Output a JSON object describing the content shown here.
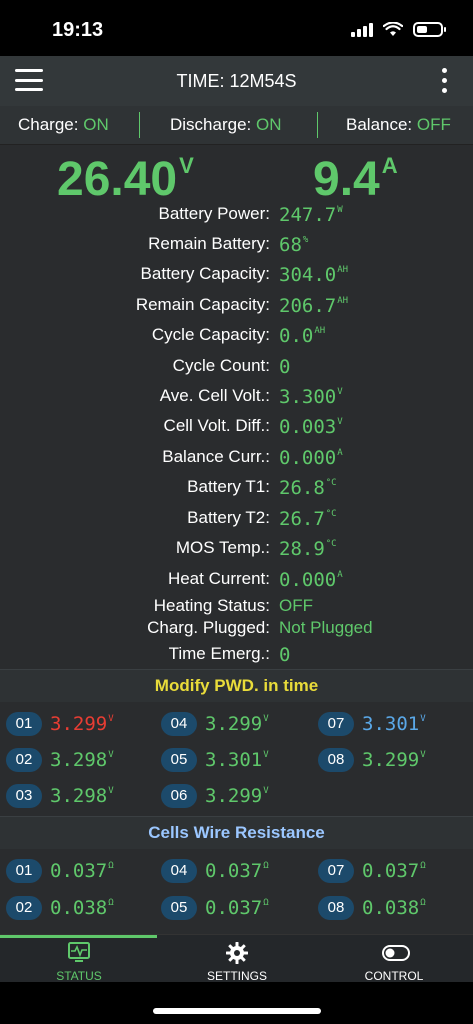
{
  "status_bar": {
    "time": "19:13"
  },
  "header": {
    "title": "TIME: 12M54S"
  },
  "switches": {
    "charge_label": "Charge:",
    "charge_value": "ON",
    "discharge_label": "Discharge:",
    "discharge_value": "ON",
    "balance_label": "Balance:",
    "balance_value": "OFF"
  },
  "main": {
    "voltage": "26.40",
    "voltage_unit": "V",
    "current": "9.4",
    "current_unit": "A"
  },
  "info": [
    {
      "label": "Battery Power:",
      "value": "247.7",
      "unit": "W"
    },
    {
      "label": "Remain Battery:",
      "value": "68",
      "unit": "%"
    },
    {
      "label": "Battery Capacity:",
      "value": "304.0",
      "unit": "AH"
    },
    {
      "label": "Remain Capacity:",
      "value": "206.7",
      "unit": "AH"
    },
    {
      "label": "Cycle Capacity:",
      "value": "0.0",
      "unit": "AH"
    },
    {
      "label": "Cycle Count:",
      "value": "0",
      "unit": ""
    },
    {
      "label": "Ave. Cell Volt.:",
      "value": "3.300",
      "unit": "V"
    },
    {
      "label": "Cell Volt. Diff.:",
      "value": "0.003",
      "unit": "V"
    },
    {
      "label": "Balance Curr.:",
      "value": "0.000",
      "unit": "A"
    },
    {
      "label": "Battery T1:",
      "value": "26.8",
      "unit": "°C"
    },
    {
      "label": "Battery T2:",
      "value": "26.7",
      "unit": "°C"
    },
    {
      "label": "MOS Temp.:",
      "value": "28.9",
      "unit": "°C"
    },
    {
      "label": "Heat Current:",
      "value": "0.000",
      "unit": "A"
    },
    {
      "label": "Heating Status:",
      "value": "OFF",
      "unit": ""
    },
    {
      "label": "Charg. Plugged:",
      "value": "Not Plugged",
      "unit": ""
    },
    {
      "label": "Time Emerg.:",
      "value": "0",
      "unit": ""
    }
  ],
  "cell_section": {
    "title": "Modify PWD. in time"
  },
  "cells": [
    {
      "index": "01",
      "value": "3.299",
      "unit": "V",
      "state": "min"
    },
    {
      "index": "04",
      "value": "3.299",
      "unit": "V",
      "state": "normal"
    },
    {
      "index": "07",
      "value": "3.301",
      "unit": "V",
      "state": "max"
    },
    {
      "index": "02",
      "value": "3.298",
      "unit": "V",
      "state": "normal"
    },
    {
      "index": "05",
      "value": "3.301",
      "unit": "V",
      "state": "normal"
    },
    {
      "index": "08",
      "value": "3.299",
      "unit": "V",
      "state": "normal"
    },
    {
      "index": "03",
      "value": "3.298",
      "unit": "V",
      "state": "normal"
    },
    {
      "index": "06",
      "value": "3.299",
      "unit": "V",
      "state": "normal"
    }
  ],
  "resistance_section": {
    "title": "Cells Wire Resistance"
  },
  "resistances": [
    {
      "index": "01",
      "value": "0.037",
      "unit": "Ω"
    },
    {
      "index": "04",
      "value": "0.037",
      "unit": "Ω"
    },
    {
      "index": "07",
      "value": "0.037",
      "unit": "Ω"
    },
    {
      "index": "02",
      "value": "0.038",
      "unit": "Ω"
    },
    {
      "index": "05",
      "value": "0.037",
      "unit": "Ω"
    },
    {
      "index": "08",
      "value": "0.038",
      "unit": "Ω"
    }
  ],
  "tabs": [
    {
      "label": "STATUS",
      "icon": "monitor-icon",
      "active": true
    },
    {
      "label": "SETTINGS",
      "icon": "gear-icon",
      "active": false
    },
    {
      "label": "CONTROL",
      "icon": "toggle-icon",
      "active": false
    }
  ],
  "colors": {
    "accent": "#5fc86b",
    "min_cell": "#e83d33",
    "max_cell": "#5aa8e8",
    "section_pwd": "#e9dc3a"
  }
}
